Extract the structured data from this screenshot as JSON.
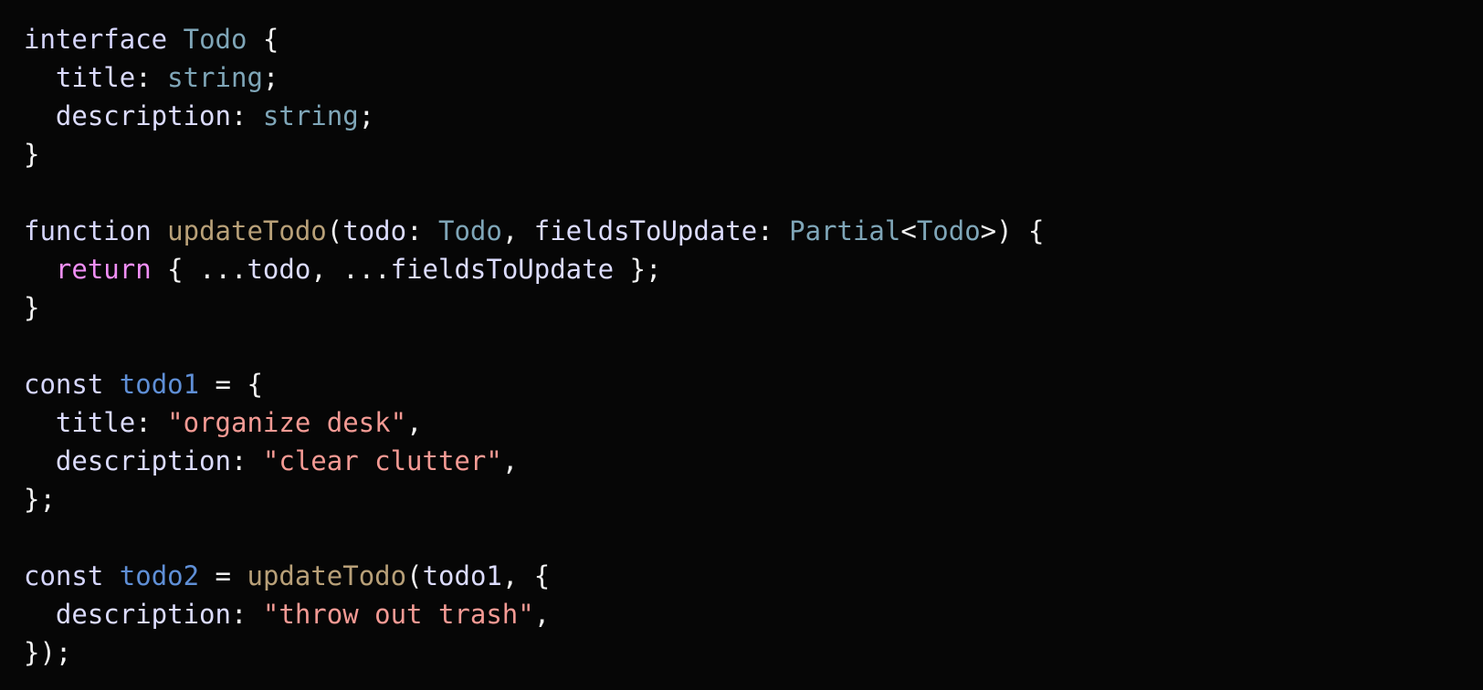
{
  "code": {
    "lines": [
      [
        {
          "t": "interface",
          "k": "keyword"
        },
        {
          "t": " ",
          "k": "plain"
        },
        {
          "t": "Todo",
          "k": "type"
        },
        {
          "t": " {",
          "k": "punct"
        }
      ],
      [
        {
          "t": "  title",
          "k": "prop"
        },
        {
          "t": ": ",
          "k": "punct"
        },
        {
          "t": "string",
          "k": "type"
        },
        {
          "t": ";",
          "k": "punct"
        }
      ],
      [
        {
          "t": "  description",
          "k": "prop"
        },
        {
          "t": ": ",
          "k": "punct"
        },
        {
          "t": "string",
          "k": "type"
        },
        {
          "t": ";",
          "k": "punct"
        }
      ],
      [
        {
          "t": "}",
          "k": "punct"
        }
      ],
      [],
      [
        {
          "t": "function",
          "k": "keyword"
        },
        {
          "t": " ",
          "k": "plain"
        },
        {
          "t": "updateTodo",
          "k": "func"
        },
        {
          "t": "(",
          "k": "punct"
        },
        {
          "t": "todo",
          "k": "prop"
        },
        {
          "t": ": ",
          "k": "punct"
        },
        {
          "t": "Todo",
          "k": "type"
        },
        {
          "t": ", ",
          "k": "punct"
        },
        {
          "t": "fieldsToUpdate",
          "k": "prop"
        },
        {
          "t": ": ",
          "k": "punct"
        },
        {
          "t": "Partial",
          "k": "type"
        },
        {
          "t": "<",
          "k": "punct"
        },
        {
          "t": "Todo",
          "k": "type"
        },
        {
          "t": ">) {",
          "k": "punct"
        }
      ],
      [
        {
          "t": "  ",
          "k": "plain"
        },
        {
          "t": "return",
          "k": "control"
        },
        {
          "t": " { ...",
          "k": "punct"
        },
        {
          "t": "todo",
          "k": "prop"
        },
        {
          "t": ", ...",
          "k": "punct"
        },
        {
          "t": "fieldsToUpdate",
          "k": "prop"
        },
        {
          "t": " };",
          "k": "punct"
        }
      ],
      [
        {
          "t": "}",
          "k": "punct"
        }
      ],
      [],
      [
        {
          "t": "const",
          "k": "keyword"
        },
        {
          "t": " ",
          "k": "plain"
        },
        {
          "t": "todo1",
          "k": "var"
        },
        {
          "t": " = {",
          "k": "punct"
        }
      ],
      [
        {
          "t": "  title",
          "k": "prop"
        },
        {
          "t": ": ",
          "k": "punct"
        },
        {
          "t": "\"organize desk\"",
          "k": "string"
        },
        {
          "t": ",",
          "k": "punct"
        }
      ],
      [
        {
          "t": "  description",
          "k": "prop"
        },
        {
          "t": ": ",
          "k": "punct"
        },
        {
          "t": "\"clear clutter\"",
          "k": "string"
        },
        {
          "t": ",",
          "k": "punct"
        }
      ],
      [
        {
          "t": "};",
          "k": "punct"
        }
      ],
      [],
      [
        {
          "t": "const",
          "k": "keyword"
        },
        {
          "t": " ",
          "k": "plain"
        },
        {
          "t": "todo2",
          "k": "var"
        },
        {
          "t": " = ",
          "k": "punct"
        },
        {
          "t": "updateTodo",
          "k": "func"
        },
        {
          "t": "(",
          "k": "punct"
        },
        {
          "t": "todo1",
          "k": "prop"
        },
        {
          "t": ", {",
          "k": "punct"
        }
      ],
      [
        {
          "t": "  description",
          "k": "prop"
        },
        {
          "t": ": ",
          "k": "punct"
        },
        {
          "t": "\"throw out trash\"",
          "k": "string"
        },
        {
          "t": ",",
          "k": "punct"
        }
      ],
      [
        {
          "t": "});",
          "k": "punct"
        }
      ]
    ]
  },
  "colors": {
    "background": "#060606",
    "keyword": "#d6d6ff",
    "control": "#f08ef5",
    "type": "#7fa6b8",
    "function": "#b8a078",
    "variable": "#5f8fd6",
    "string": "#f49a94",
    "property": "#dcdcff",
    "punctuation": "#f2f2f2"
  }
}
